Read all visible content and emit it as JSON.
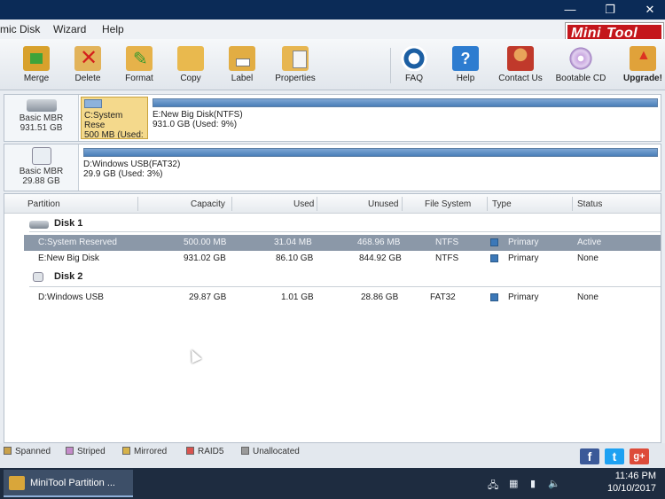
{
  "menu": [
    "mic Disk",
    "Wizard",
    "Help"
  ],
  "window_controls": [
    "—",
    "❐",
    "✕"
  ],
  "logo": {
    "text1": "Mini",
    "text2": "Tool"
  },
  "toolbar": [
    {
      "label": "Merge",
      "icon": "merge-icon"
    },
    {
      "label": "Delete",
      "icon": "delete-icon"
    },
    {
      "label": "Format",
      "icon": "format-icon"
    },
    {
      "label": "Copy",
      "icon": "copy-icon"
    },
    {
      "label": "Label",
      "icon": "label-icon"
    },
    {
      "label": "Properties",
      "icon": "properties-icon"
    },
    {
      "label": "FAQ",
      "icon": "faq-icon"
    },
    {
      "label": "Help",
      "icon": "help-icon"
    },
    {
      "label": "Contact Us",
      "icon": "contact-icon"
    },
    {
      "label": "Bootable CD",
      "icon": "bootable-cd-icon"
    },
    {
      "label": "Upgrade!",
      "icon": "upgrade-icon"
    }
  ],
  "disk1": {
    "type": "Basic MBR",
    "size": "931.51 GB",
    "p1": {
      "name": "C:System Rese",
      "detail": "500 MB (Used:"
    },
    "p2": {
      "name": "E:New Big Disk(NTFS)",
      "detail": "931.0 GB (Used: 9%)"
    }
  },
  "disk2": {
    "type": "Basic MBR",
    "size": "29.88 GB",
    "p1": {
      "name": "D:Windows USB(FAT32)",
      "detail": "29.9 GB (Used: 3%)"
    }
  },
  "table": {
    "headers": [
      "Partition",
      "Capacity",
      "Used",
      "Unused",
      "File System",
      "Type",
      "Status"
    ],
    "group1": "Disk 1",
    "group2": "Disk 2",
    "rows1": [
      {
        "partition": "C:System Reserved",
        "capacity": "500.00 MB",
        "used": "31.04 MB",
        "unused": "468.96 MB",
        "fs": "NTFS",
        "type": "Primary",
        "status": "Active"
      },
      {
        "partition": "E:New Big Disk",
        "capacity": "931.02 GB",
        "used": "86.10 GB",
        "unused": "844.92 GB",
        "fs": "NTFS",
        "type": "Primary",
        "status": "None"
      }
    ],
    "rows2": [
      {
        "partition": "D:Windows USB",
        "capacity": "29.87 GB",
        "used": "1.01 GB",
        "unused": "28.86 GB",
        "fs": "FAT32",
        "type": "Primary",
        "status": "None"
      }
    ]
  },
  "legend": [
    {
      "label": "Spanned",
      "color": "#c9a14a"
    },
    {
      "label": "Striped",
      "color": "#c48bc9"
    },
    {
      "label": "Mirrored",
      "color": "#d6b24a"
    },
    {
      "label": "RAID5",
      "color": "#d9534f"
    },
    {
      "label": "Unallocated",
      "color": "#9a9a9a"
    }
  ],
  "social": [
    "f",
    "t",
    "g+"
  ],
  "taskbar": {
    "app": "MiniTool Partition ...",
    "time": "11:46 PM",
    "date": "10/10/2017"
  }
}
